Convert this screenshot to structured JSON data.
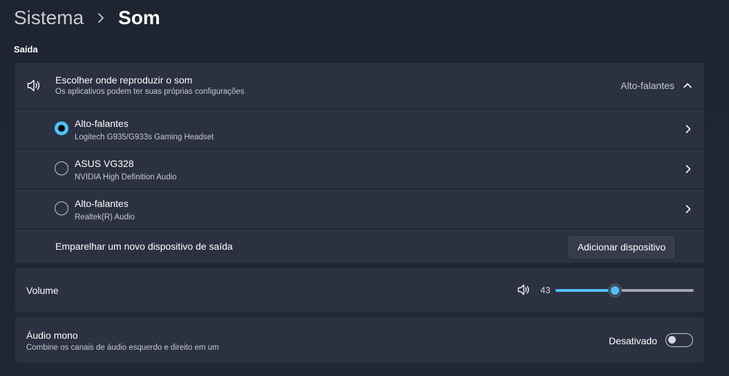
{
  "breadcrumb": {
    "parent": "Sistema",
    "current": "Som"
  },
  "output": {
    "section_title": "Saída",
    "header": {
      "title": "Escolher onde reproduzir o som",
      "subtitle": "Os aplicativos podem ter suas próprias configurações",
      "selected_device": "Alto-falantes",
      "icon": "speaker-icon",
      "expanded": true
    },
    "devices": [
      {
        "name": "Alto-falantes",
        "description": "Logitech G935/G933s Gaming Headset",
        "selected": true
      },
      {
        "name": "ASUS VG328",
        "description": "NVIDIA High Definition Audio",
        "selected": false
      },
      {
        "name": "Alto-falantes",
        "description": "Realtek(R) Audio",
        "selected": false
      }
    ],
    "pair": {
      "label": "Emparelhar um novo dispositivo de saída",
      "button": "Adicionar dispositivo"
    }
  },
  "volume": {
    "label": "Volume",
    "value": "43",
    "level_percent": 43
  },
  "mono": {
    "title": "Áudio mono",
    "subtitle": "Combine os canais de áudio esquerdo e direito em um",
    "state_label": "Desativado",
    "enabled": false
  },
  "colors": {
    "accent": "#4cc2ff",
    "background": "#202636",
    "card": "#2b3140"
  }
}
